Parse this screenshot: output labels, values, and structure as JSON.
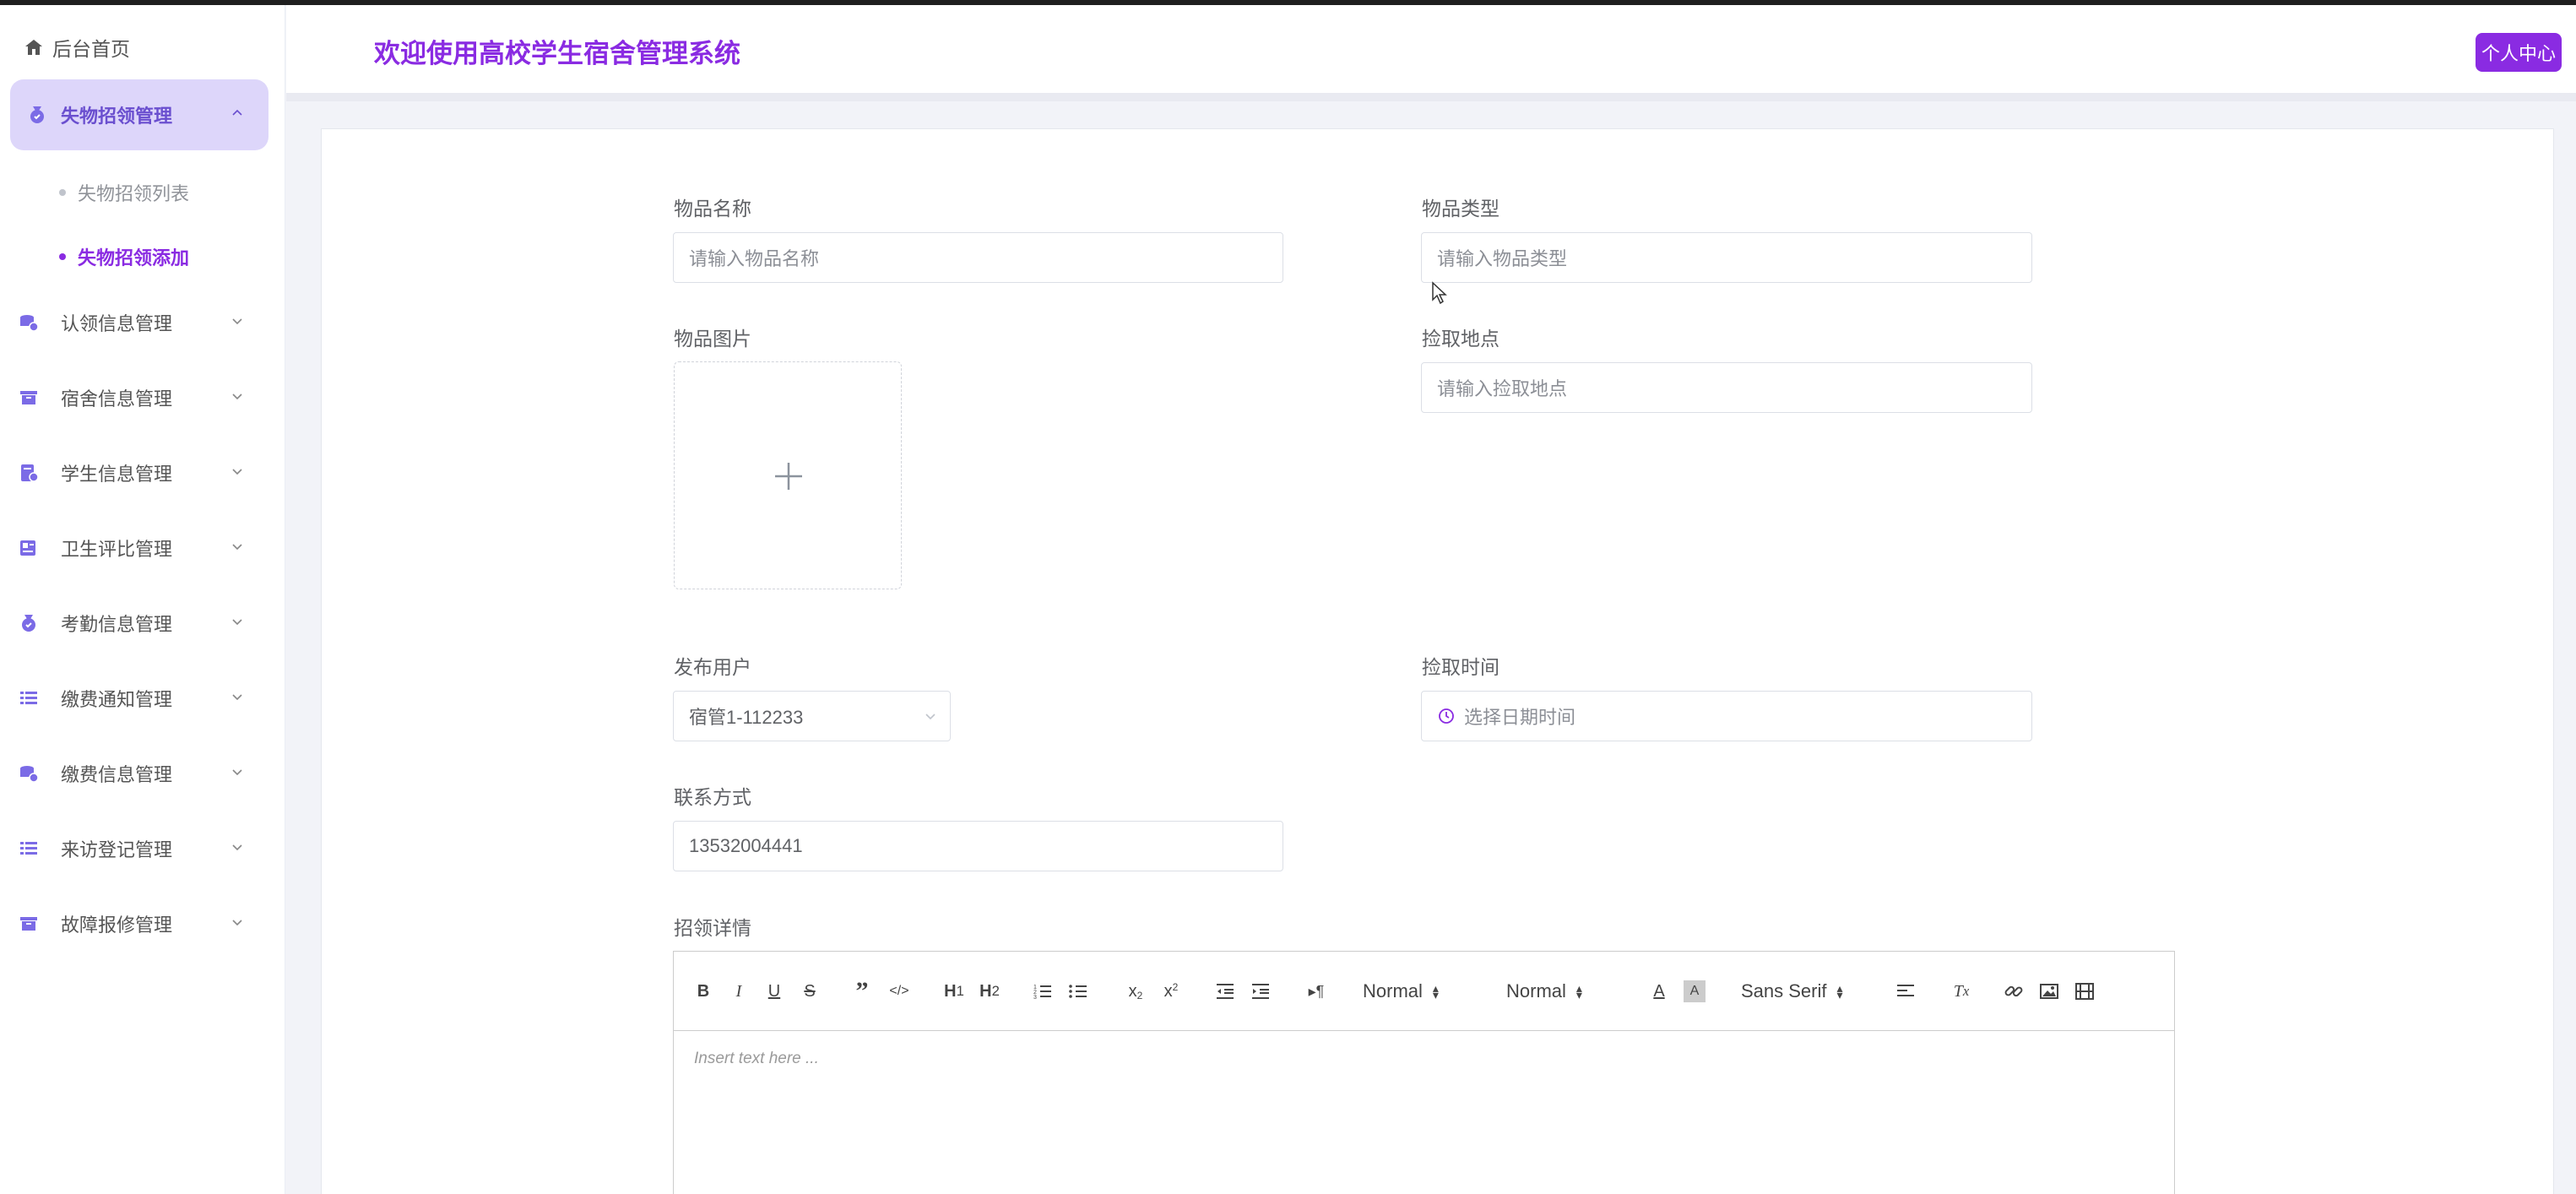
{
  "sidebar": {
    "home_label": "后台首页",
    "active_menu": {
      "label": "失物招领管理",
      "children": [
        {
          "label": "失物招领列表"
        },
        {
          "label": "失物招领添加"
        }
      ]
    },
    "items": [
      {
        "label": "认领信息管理",
        "icon": "database-user-icon"
      },
      {
        "label": "宿舍信息管理",
        "icon": "archive-icon"
      },
      {
        "label": "学生信息管理",
        "icon": "document-user-icon"
      },
      {
        "label": "卫生评比管理",
        "icon": "news-icon"
      },
      {
        "label": "考勤信息管理",
        "icon": "medal-icon"
      },
      {
        "label": "缴费通知管理",
        "icon": "list-icon"
      },
      {
        "label": "缴费信息管理",
        "icon": "database-user-icon"
      },
      {
        "label": "来访登记管理",
        "icon": "list-icon"
      },
      {
        "label": "故障报修管理",
        "icon": "archive-icon"
      }
    ]
  },
  "header": {
    "title": "欢迎使用高校学生宿舍管理系统",
    "profile_button": "个人中心"
  },
  "form": {
    "name": {
      "label": "物品名称",
      "placeholder": "请输入物品名称"
    },
    "type": {
      "label": "物品类型",
      "placeholder": "请输入物品类型"
    },
    "image": {
      "label": "物品图片"
    },
    "location": {
      "label": "捡取地点",
      "placeholder": "请输入捡取地点"
    },
    "publisher": {
      "label": "发布用户",
      "value": "宿管1-112233"
    },
    "pick_time": {
      "label": "捡取时间",
      "placeholder": "选择日期时间"
    },
    "contact": {
      "label": "联系方式",
      "value": "13532004441"
    },
    "details": {
      "label": "招领详情"
    }
  },
  "editor": {
    "header_select": "Normal",
    "size_select": "Normal",
    "font_select": "Sans Serif",
    "placeholder": "Insert text here ..."
  },
  "colors": {
    "accent": "#8a2be2",
    "active_menu_bg": "#ddd6fa",
    "menu_icon": "#7b6be6"
  }
}
